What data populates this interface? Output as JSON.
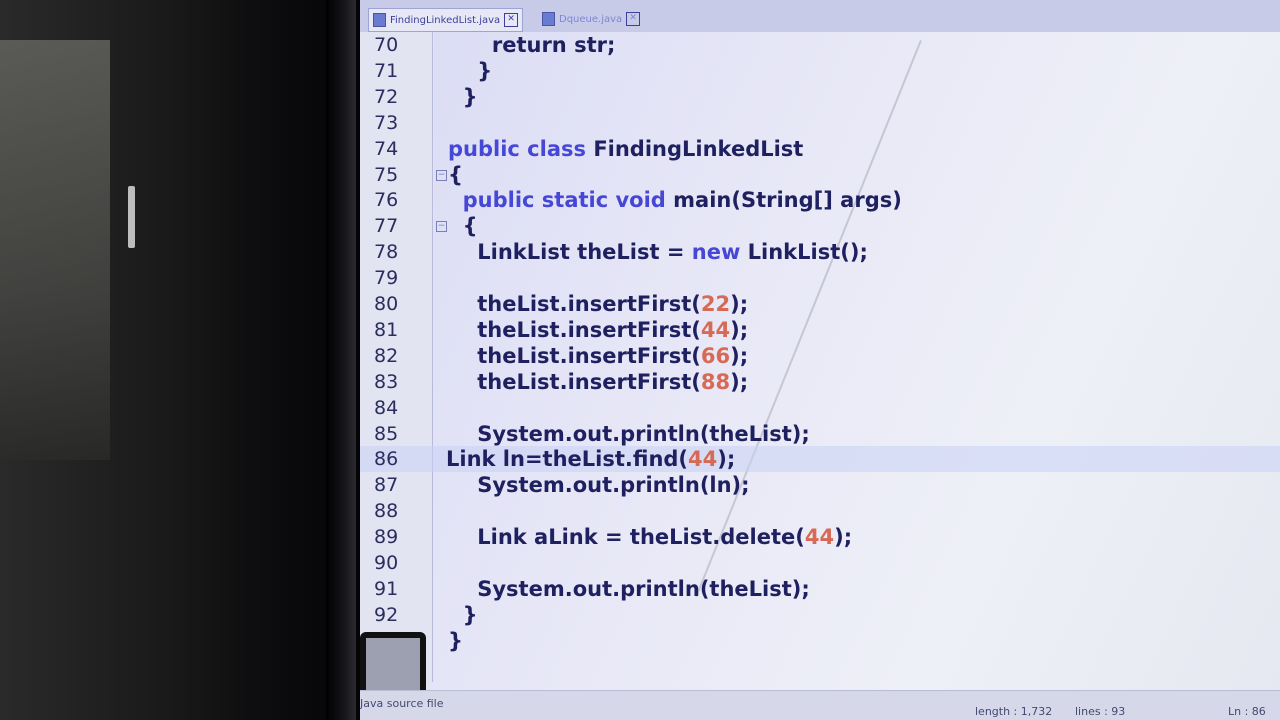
{
  "tabs": [
    {
      "label": "FindingLinkedList.java",
      "active": true
    },
    {
      "label": "Dqueue.java",
      "active": false
    }
  ],
  "code_lines": [
    {
      "num": "70",
      "code": [
        {
          "t": "      return str;",
          "k": ""
        }
      ]
    },
    {
      "num": "71",
      "code": [
        {
          "t": "    }",
          "k": ""
        }
      ]
    },
    {
      "num": "72",
      "code": [
        {
          "t": "  }",
          "k": ""
        }
      ]
    },
    {
      "num": "73",
      "code": []
    },
    {
      "num": "74",
      "code": [
        {
          "t": "public class ",
          "k": "kw"
        },
        {
          "t": "FindingLinkedList",
          "k": ""
        }
      ]
    },
    {
      "num": "75",
      "code": [
        {
          "t": "{",
          "k": ""
        }
      ],
      "fold": true
    },
    {
      "num": "76",
      "code": [
        {
          "t": "  public static void ",
          "k": "kw"
        },
        {
          "t": "main(String[] args)",
          "k": ""
        }
      ]
    },
    {
      "num": "77",
      "code": [
        {
          "t": "  {",
          "k": ""
        }
      ],
      "fold": true
    },
    {
      "num": "78",
      "code": [
        {
          "t": "    LinkList theList = ",
          "k": ""
        },
        {
          "t": "new ",
          "k": "kw"
        },
        {
          "t": "LinkList();",
          "k": ""
        }
      ]
    },
    {
      "num": "79",
      "code": []
    },
    {
      "num": "80",
      "code": [
        {
          "t": "    theList.insertFirst(",
          "k": ""
        },
        {
          "t": "22",
          "k": "num"
        },
        {
          "t": ");",
          "k": ""
        }
      ]
    },
    {
      "num": "81",
      "code": [
        {
          "t": "    theList.insertFirst(",
          "k": ""
        },
        {
          "t": "44",
          "k": "num"
        },
        {
          "t": ");",
          "k": ""
        }
      ]
    },
    {
      "num": "82",
      "code": [
        {
          "t": "    theList.insertFirst(",
          "k": ""
        },
        {
          "t": "66",
          "k": "num"
        },
        {
          "t": ");",
          "k": ""
        }
      ]
    },
    {
      "num": "83",
      "code": [
        {
          "t": "    theList.insertFirst(",
          "k": ""
        },
        {
          "t": "88",
          "k": "num"
        },
        {
          "t": ");",
          "k": ""
        }
      ]
    },
    {
      "num": "84",
      "code": []
    },
    {
      "num": "85",
      "code": [
        {
          "t": "    System.out.println(theList);",
          "k": ""
        }
      ]
    },
    {
      "num": "86",
      "code": [
        {
          "t": "Link ln=theList.find(",
          "k": ""
        },
        {
          "t": "44",
          "k": "num"
        },
        {
          "t": ");",
          "k": ""
        }
      ],
      "current": true
    },
    {
      "num": "87",
      "code": [
        {
          "t": "    System.out.println(ln);",
          "k": ""
        }
      ]
    },
    {
      "num": "88",
      "code": []
    },
    {
      "num": "89",
      "code": [
        {
          "t": "    Link aLink = theList.delete(",
          "k": ""
        },
        {
          "t": "44",
          "k": "num"
        },
        {
          "t": ");",
          "k": ""
        }
      ]
    },
    {
      "num": "90",
      "code": []
    },
    {
      "num": "91",
      "code": [
        {
          "t": "    System.out.println(theList);",
          "k": ""
        }
      ]
    },
    {
      "num": "92",
      "code": [
        {
          "t": "  }",
          "k": ""
        }
      ]
    },
    {
      "num": "",
      "code": [
        {
          "t": "}",
          "k": ""
        }
      ]
    }
  ],
  "status": {
    "type": "Java source file",
    "length": "length : 1,732",
    "lines": "lines : 93",
    "ln": "Ln : 86"
  },
  "colors": {
    "keyword": "#4747d6",
    "number": "#d76a55",
    "text": "#1f2060"
  }
}
